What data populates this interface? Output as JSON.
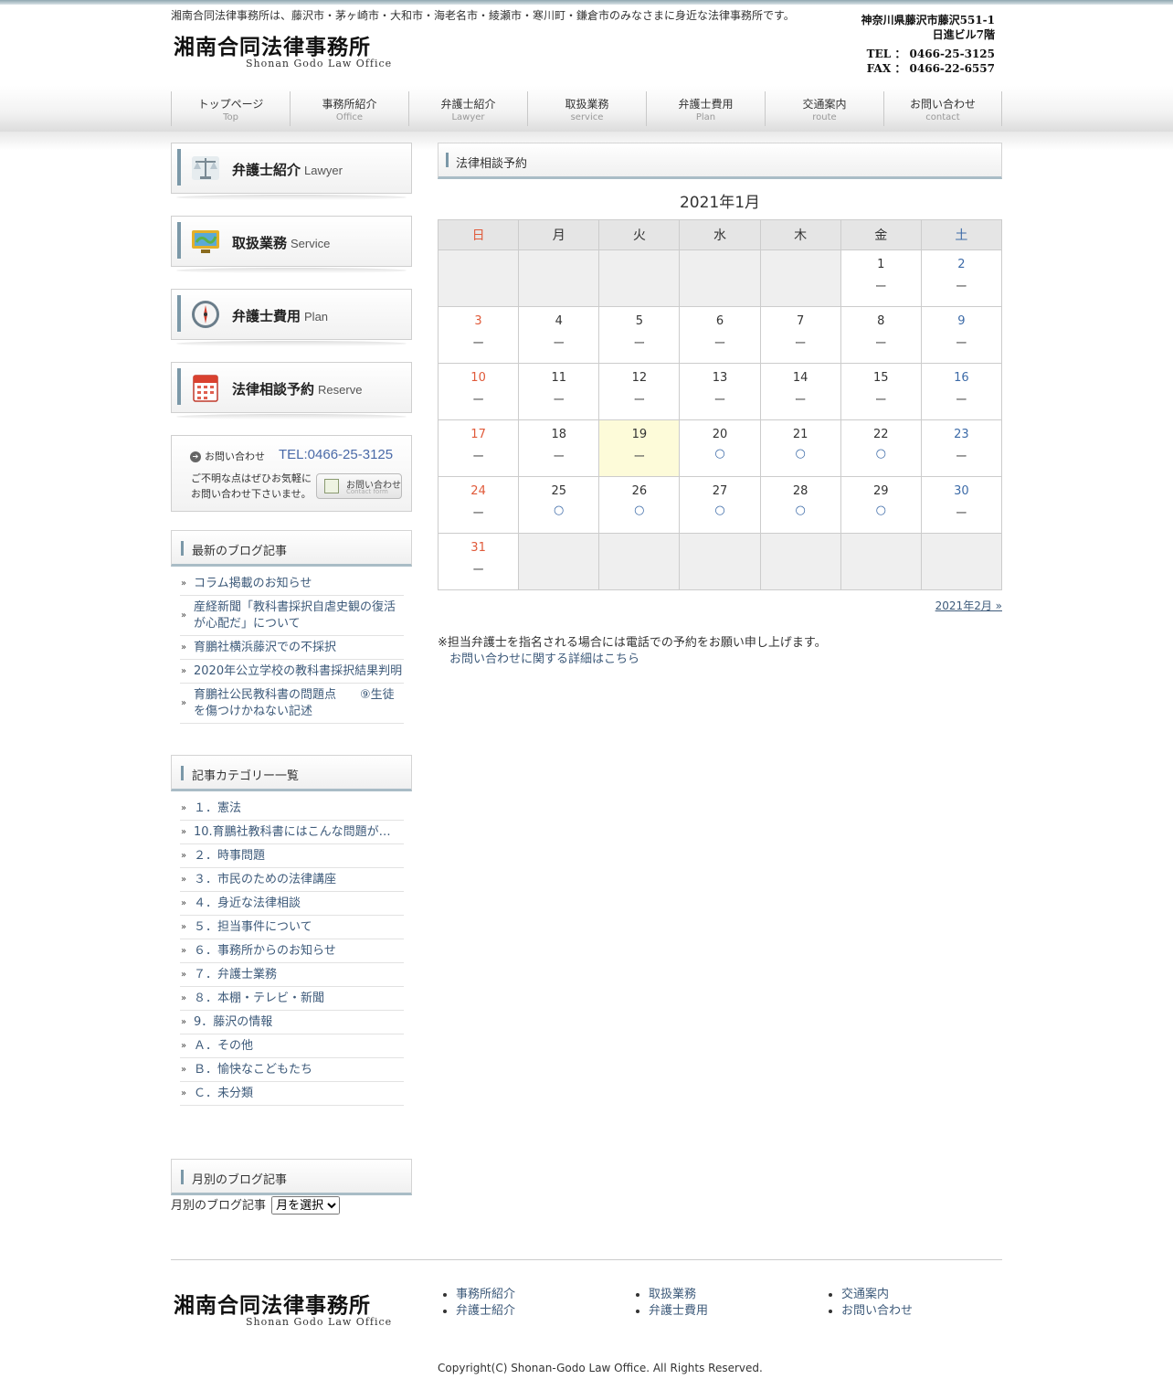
{
  "header": {
    "tagline": "湘南合同法律事務所は、藤沢市・茅ヶ崎市・大和市・海老名市・綾瀬市・寒川町・鎌倉市のみなさまに身近な法律事務所です。",
    "logo_jp": "湘南合同法律事務所",
    "logo_en": "Shonan Godo Law Office",
    "address1": "神奈川県藤沢市藤沢551-1",
    "address2": "日進ビル7階",
    "tel": "TEL ： 0466-25-3125",
    "fax": "FAX ： 0466-22-6557"
  },
  "nav": [
    {
      "jp": "トップページ",
      "en": "Top"
    },
    {
      "jp": "事務所紹介",
      "en": "Office"
    },
    {
      "jp": "弁護士紹介",
      "en": "Lawyer"
    },
    {
      "jp": "取扱業務",
      "en": "service"
    },
    {
      "jp": "弁護士費用",
      "en": "Plan"
    },
    {
      "jp": "交通案内",
      "en": "route"
    },
    {
      "jp": "お問い合わせ",
      "en": "contact"
    }
  ],
  "sidebar": {
    "buttons": [
      {
        "jp": "弁護士紹介",
        "en": "Lawyer",
        "icon": "scales-icon"
      },
      {
        "jp": "取扱業務",
        "en": "Service",
        "icon": "monitor-icon"
      },
      {
        "jp": "弁護士費用",
        "en": "Plan",
        "icon": "compass-icon"
      },
      {
        "jp": "法律相談予約",
        "en": "Reserve",
        "icon": "calendar-icon"
      }
    ],
    "contact": {
      "label": "お問い合わせ",
      "tel": "TEL:0466-25-3125",
      "msg1": "ご不明な点はぜひお気軽に",
      "msg2": "お問い合わせ下さいませ。",
      "button": "お問い合わせ",
      "button_en": "Contact form"
    },
    "recent_title": "最新のブログ記事",
    "recent": [
      "コラム掲載のお知らせ",
      "産経新聞「教科書採択自虐史観の復活が心配だ」について",
      "育鵬社横浜藤沢での不採択",
      "2020年公立学校の教科書採択結果判明",
      "育鵬社公民教科書の問題点　　⑨生徒を傷つけかねない記述"
    ],
    "categories_title": "記事カテゴリー一覧",
    "categories": [
      "１．憲法",
      "10.育鵬社教科書にはこんな問題が…",
      "２．時事問題",
      "３．市民のための法律講座",
      "４．身近な法律相談",
      "５．担当事件について",
      "６．事務所からのお知らせ",
      "７．弁護士業務",
      "８．本棚・テレビ・新聞",
      "9．藤沢の情報",
      "Ａ．その他",
      "Ｂ．愉快なこどもたち",
      "Ｃ．未分類"
    ],
    "monthly_title": "月別のブログ記事",
    "monthly_label": "月別のブログ記事",
    "monthly_select": "月を選択"
  },
  "main": {
    "heading": "法律相談予約",
    "calendar_title": "2021年1月",
    "weekdays": [
      "日",
      "月",
      "火",
      "水",
      "木",
      "金",
      "土"
    ],
    "weeks": [
      [
        null,
        null,
        null,
        null,
        null,
        {
          "d": "1",
          "m": "ー"
        },
        {
          "d": "2",
          "m": "ー"
        }
      ],
      [
        {
          "d": "3",
          "m": "ー"
        },
        {
          "d": "4",
          "m": "ー"
        },
        {
          "d": "5",
          "m": "ー"
        },
        {
          "d": "6",
          "m": "ー"
        },
        {
          "d": "7",
          "m": "ー"
        },
        {
          "d": "8",
          "m": "ー"
        },
        {
          "d": "9",
          "m": "ー"
        }
      ],
      [
        {
          "d": "10",
          "m": "ー"
        },
        {
          "d": "11",
          "m": "ー"
        },
        {
          "d": "12",
          "m": "ー"
        },
        {
          "d": "13",
          "m": "ー"
        },
        {
          "d": "14",
          "m": "ー"
        },
        {
          "d": "15",
          "m": "ー"
        },
        {
          "d": "16",
          "m": "ー"
        }
      ],
      [
        {
          "d": "17",
          "m": "ー"
        },
        {
          "d": "18",
          "m": "ー"
        },
        {
          "d": "19",
          "m": "ー",
          "today": true
        },
        {
          "d": "20",
          "m": "○"
        },
        {
          "d": "21",
          "m": "○"
        },
        {
          "d": "22",
          "m": "○"
        },
        {
          "d": "23",
          "m": "ー"
        }
      ],
      [
        {
          "d": "24",
          "m": "ー"
        },
        {
          "d": "25",
          "m": "○"
        },
        {
          "d": "26",
          "m": "○"
        },
        {
          "d": "27",
          "m": "○"
        },
        {
          "d": "28",
          "m": "○"
        },
        {
          "d": "29",
          "m": "○"
        },
        {
          "d": "30",
          "m": "ー"
        }
      ],
      [
        {
          "d": "31",
          "m": "ー"
        },
        null,
        null,
        null,
        null,
        null,
        null
      ]
    ],
    "next_month": "2021年2月 »",
    "note": "※担当弁護士を指名される場合には電話での予約をお願い申し上げます。",
    "note_link": "お問い合わせに関する詳細はこちら"
  },
  "footer": {
    "logo_jp": "湘南合同法律事務所",
    "logo_en": "Shonan Godo Law Office",
    "col1": [
      "事務所紹介",
      "弁護士紹介"
    ],
    "col2": [
      "取扱業務",
      "弁護士費用"
    ],
    "col3": [
      "交通案内",
      "お問い合わせ"
    ],
    "copyright": "Copyright(C) Shonan-Godo Law Office. All Rights Reserved."
  }
}
